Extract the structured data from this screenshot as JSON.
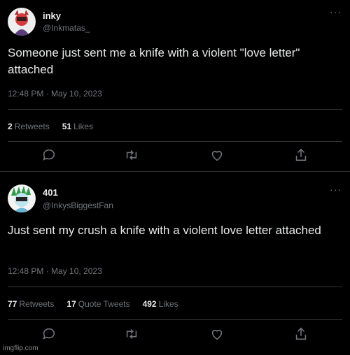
{
  "tweets": [
    {
      "name": "inky",
      "handle": "@Inkmatas_",
      "text": "Someone just sent me a knife with a violent \"love letter\" attached",
      "timestamp": "12:48 PM · May 10, 2023",
      "stats": [
        {
          "count": "2",
          "label": "Retweets"
        },
        {
          "count": "51",
          "label": "Likes"
        }
      ]
    },
    {
      "name": "401",
      "handle": "@InkysBiggestFan",
      "text": "Just sent my crush a knife with a violent love letter attached",
      "timestamp": "12:48 PM · May 10, 2023",
      "stats": [
        {
          "count": "77",
          "label": "Retweets"
        },
        {
          "count": "17",
          "label": "Quote Tweets"
        },
        {
          "count": "492",
          "label": "Likes"
        }
      ]
    }
  ],
  "more_icon": "···",
  "watermark": "imgflip.com",
  "colors": {
    "background": "#000000",
    "text": "#e7e9ea",
    "muted": "#71767b",
    "divider": "#2f3336"
  },
  "icons": [
    "reply-icon",
    "retweet-icon",
    "like-icon",
    "share-icon"
  ]
}
